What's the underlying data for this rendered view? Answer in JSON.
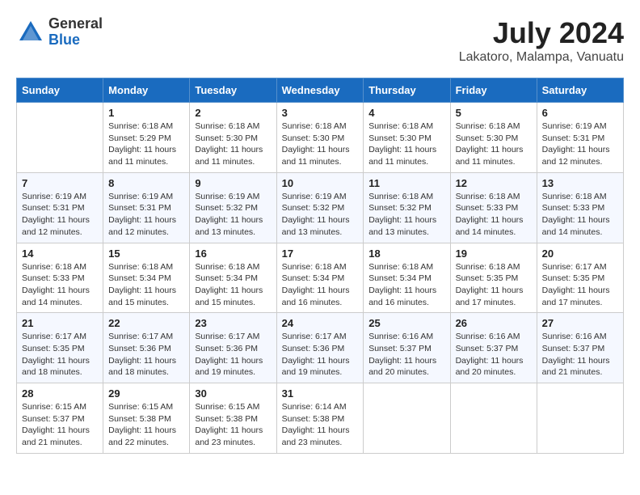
{
  "logo": {
    "general": "General",
    "blue": "Blue"
  },
  "header": {
    "month_year": "July 2024",
    "location": "Lakatoro, Malampa, Vanuatu"
  },
  "weekdays": [
    "Sunday",
    "Monday",
    "Tuesday",
    "Wednesday",
    "Thursday",
    "Friday",
    "Saturday"
  ],
  "weeks": [
    [
      {
        "day": "",
        "info": ""
      },
      {
        "day": "1",
        "info": "Sunrise: 6:18 AM\nSunset: 5:29 PM\nDaylight: 11 hours\nand 11 minutes."
      },
      {
        "day": "2",
        "info": "Sunrise: 6:18 AM\nSunset: 5:30 PM\nDaylight: 11 hours\nand 11 minutes."
      },
      {
        "day": "3",
        "info": "Sunrise: 6:18 AM\nSunset: 5:30 PM\nDaylight: 11 hours\nand 11 minutes."
      },
      {
        "day": "4",
        "info": "Sunrise: 6:18 AM\nSunset: 5:30 PM\nDaylight: 11 hours\nand 11 minutes."
      },
      {
        "day": "5",
        "info": "Sunrise: 6:18 AM\nSunset: 5:30 PM\nDaylight: 11 hours\nand 11 minutes."
      },
      {
        "day": "6",
        "info": "Sunrise: 6:19 AM\nSunset: 5:31 PM\nDaylight: 11 hours\nand 12 minutes."
      }
    ],
    [
      {
        "day": "7",
        "info": "Sunrise: 6:19 AM\nSunset: 5:31 PM\nDaylight: 11 hours\nand 12 minutes."
      },
      {
        "day": "8",
        "info": "Sunrise: 6:19 AM\nSunset: 5:31 PM\nDaylight: 11 hours\nand 12 minutes."
      },
      {
        "day": "9",
        "info": "Sunrise: 6:19 AM\nSunset: 5:32 PM\nDaylight: 11 hours\nand 13 minutes."
      },
      {
        "day": "10",
        "info": "Sunrise: 6:19 AM\nSunset: 5:32 PM\nDaylight: 11 hours\nand 13 minutes."
      },
      {
        "day": "11",
        "info": "Sunrise: 6:18 AM\nSunset: 5:32 PM\nDaylight: 11 hours\nand 13 minutes."
      },
      {
        "day": "12",
        "info": "Sunrise: 6:18 AM\nSunset: 5:33 PM\nDaylight: 11 hours\nand 14 minutes."
      },
      {
        "day": "13",
        "info": "Sunrise: 6:18 AM\nSunset: 5:33 PM\nDaylight: 11 hours\nand 14 minutes."
      }
    ],
    [
      {
        "day": "14",
        "info": "Sunrise: 6:18 AM\nSunset: 5:33 PM\nDaylight: 11 hours\nand 14 minutes."
      },
      {
        "day": "15",
        "info": "Sunrise: 6:18 AM\nSunset: 5:34 PM\nDaylight: 11 hours\nand 15 minutes."
      },
      {
        "day": "16",
        "info": "Sunrise: 6:18 AM\nSunset: 5:34 PM\nDaylight: 11 hours\nand 15 minutes."
      },
      {
        "day": "17",
        "info": "Sunrise: 6:18 AM\nSunset: 5:34 PM\nDaylight: 11 hours\nand 16 minutes."
      },
      {
        "day": "18",
        "info": "Sunrise: 6:18 AM\nSunset: 5:34 PM\nDaylight: 11 hours\nand 16 minutes."
      },
      {
        "day": "19",
        "info": "Sunrise: 6:18 AM\nSunset: 5:35 PM\nDaylight: 11 hours\nand 17 minutes."
      },
      {
        "day": "20",
        "info": "Sunrise: 6:17 AM\nSunset: 5:35 PM\nDaylight: 11 hours\nand 17 minutes."
      }
    ],
    [
      {
        "day": "21",
        "info": "Sunrise: 6:17 AM\nSunset: 5:35 PM\nDaylight: 11 hours\nand 18 minutes."
      },
      {
        "day": "22",
        "info": "Sunrise: 6:17 AM\nSunset: 5:36 PM\nDaylight: 11 hours\nand 18 minutes."
      },
      {
        "day": "23",
        "info": "Sunrise: 6:17 AM\nSunset: 5:36 PM\nDaylight: 11 hours\nand 19 minutes."
      },
      {
        "day": "24",
        "info": "Sunrise: 6:17 AM\nSunset: 5:36 PM\nDaylight: 11 hours\nand 19 minutes."
      },
      {
        "day": "25",
        "info": "Sunrise: 6:16 AM\nSunset: 5:37 PM\nDaylight: 11 hours\nand 20 minutes."
      },
      {
        "day": "26",
        "info": "Sunrise: 6:16 AM\nSunset: 5:37 PM\nDaylight: 11 hours\nand 20 minutes."
      },
      {
        "day": "27",
        "info": "Sunrise: 6:16 AM\nSunset: 5:37 PM\nDaylight: 11 hours\nand 21 minutes."
      }
    ],
    [
      {
        "day": "28",
        "info": "Sunrise: 6:15 AM\nSunset: 5:37 PM\nDaylight: 11 hours\nand 21 minutes."
      },
      {
        "day": "29",
        "info": "Sunrise: 6:15 AM\nSunset: 5:38 PM\nDaylight: 11 hours\nand 22 minutes."
      },
      {
        "day": "30",
        "info": "Sunrise: 6:15 AM\nSunset: 5:38 PM\nDaylight: 11 hours\nand 23 minutes."
      },
      {
        "day": "31",
        "info": "Sunrise: 6:14 AM\nSunset: 5:38 PM\nDaylight: 11 hours\nand 23 minutes."
      },
      {
        "day": "",
        "info": ""
      },
      {
        "day": "",
        "info": ""
      },
      {
        "day": "",
        "info": ""
      }
    ]
  ]
}
